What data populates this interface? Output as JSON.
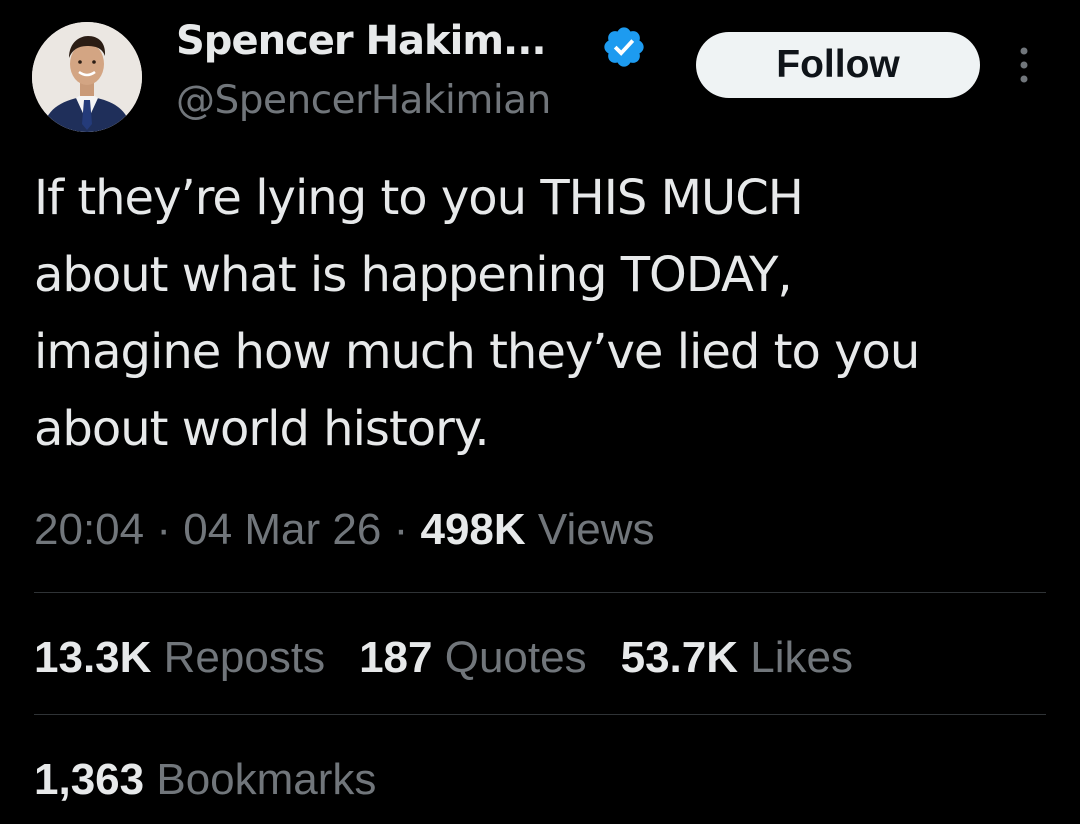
{
  "author": {
    "display_name": "Spencer Hakim...",
    "handle": "@SpencerHakimian",
    "verified": true,
    "verified_color": "#1d9bf0"
  },
  "actions": {
    "follow_label": "Follow",
    "more_icon": "more-vertical-icon"
  },
  "tweet": {
    "text": "If they’re lying to you THIS MUCH\nabout what is happening TODAY,\nimagine how much they’ve lied to you\nabout world history."
  },
  "meta": {
    "time": "20:04",
    "separator": "·",
    "date": "04 Mar 26",
    "views_count": "498K",
    "views_label": "Views"
  },
  "stats": {
    "reposts_count": "13.3K",
    "reposts_label": "Reposts",
    "quotes_count": "187",
    "quotes_label": "Quotes",
    "likes_count": "53.7K",
    "likes_label": "Likes",
    "bookmarks_count": "1,363",
    "bookmarks_label": "Bookmarks"
  },
  "colors": {
    "background": "#000000",
    "primary_text": "#e7e9ea",
    "secondary_text": "#71767b",
    "divider": "#2f3336",
    "follow_button_bg": "#eff3f4"
  }
}
